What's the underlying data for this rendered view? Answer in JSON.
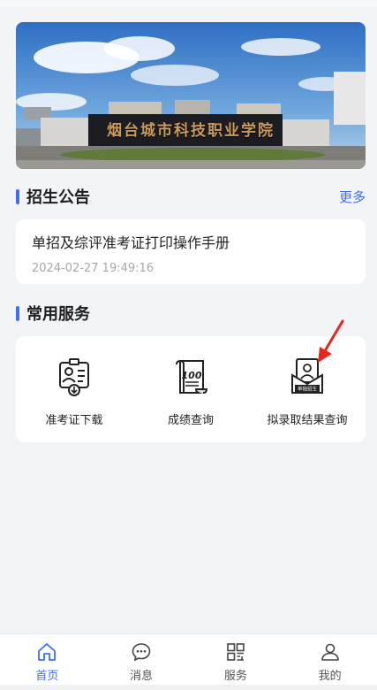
{
  "banner": {
    "school_name": "烟台城市科技职业学院"
  },
  "notice_section": {
    "title": "招生公告",
    "more_label": "更多"
  },
  "notice": {
    "title": "单招及综评准考证打印操作手册",
    "time": "2024-02-27 19:49:16"
  },
  "services_section": {
    "title": "常用服务"
  },
  "services": [
    {
      "label": "准考证下载",
      "icon": "admission-ticket-icon"
    },
    {
      "label": "成绩查询",
      "icon": "score-scroll-icon"
    },
    {
      "label": "拟录取结果查询",
      "icon": "admission-result-icon",
      "badge_text": "单独招生"
    }
  ],
  "nav": {
    "items": [
      {
        "label": "首页",
        "icon": "home-icon",
        "active": true
      },
      {
        "label": "消息",
        "icon": "message-icon",
        "active": false
      },
      {
        "label": "服务",
        "icon": "grid-icon",
        "active": false
      },
      {
        "label": "我的",
        "icon": "user-icon",
        "active": false
      }
    ]
  },
  "colors": {
    "accent": "#3f6ff0",
    "background": "#f2f4f7",
    "annotation_arrow": "#e8281f"
  }
}
